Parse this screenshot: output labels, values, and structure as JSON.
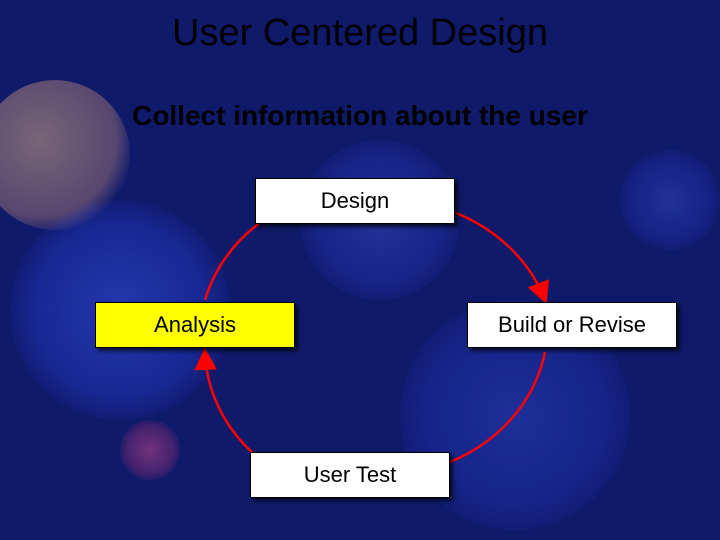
{
  "title": "User Centered Design",
  "subtitle": "Collect information about the user",
  "nodes": {
    "design": "Design",
    "build": "Build or Revise",
    "test": "User Test",
    "analysis": "Analysis"
  },
  "cycle_order": [
    "design",
    "build",
    "test",
    "analysis"
  ],
  "highlighted_node": "analysis",
  "colors": {
    "background": "#0f1a6a",
    "arrow": "#ff0000",
    "box": "#ffffff",
    "highlight_box": "#ffff00",
    "text": "#000000"
  }
}
